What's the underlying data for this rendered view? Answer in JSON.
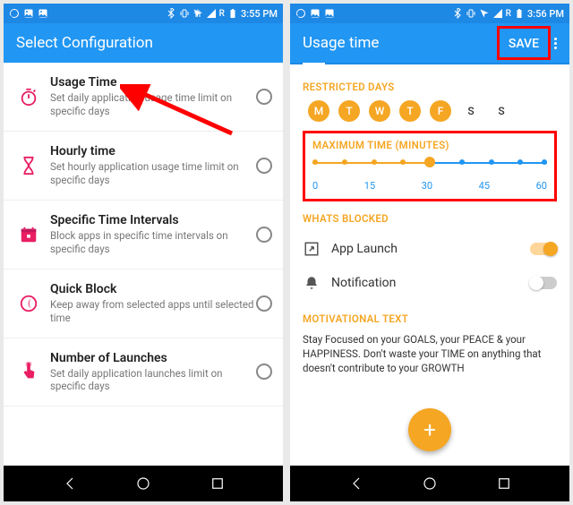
{
  "status": {
    "time_left": "3:55 PM",
    "time_right": "3:56 PM",
    "carrier": "R"
  },
  "left": {
    "title": "Select Configuration",
    "rows": [
      {
        "title": "Usage Time",
        "sub": "Set daily application usage time limit on specific days"
      },
      {
        "title": "Hourly time",
        "sub": "Set hourly application usage time limit on specific days"
      },
      {
        "title": "Specific Time Intervals",
        "sub": "Block apps in specific time intervals on specific days"
      },
      {
        "title": "Quick Block",
        "sub": "Keep away from selected apps until selected time"
      },
      {
        "title": "Number of Launches",
        "sub": "Set daily application launches limit on specific days"
      }
    ]
  },
  "right": {
    "title": "Usage time",
    "save": "SAVE",
    "sect_days": "RESTRICTED DAYS",
    "days": [
      "M",
      "T",
      "W",
      "T",
      "F",
      "S",
      "S"
    ],
    "sect_max": "MAXIMUM TIME (MINUTES)",
    "slider_labels": [
      "0",
      "15",
      "30",
      "45",
      "60"
    ],
    "sect_blocked": "WHATS BLOCKED",
    "blocked": [
      {
        "label": "App Launch",
        "on": true
      },
      {
        "label": "Notification",
        "on": false
      }
    ],
    "sect_mot": "MOTIVATIONAL TEXT",
    "mot": "Stay Focused on your GOALS, your PEACE & your HAPPINESS. Don't waste your TIME on anything that doesn't contribute to your GROWTH",
    "fab": "+"
  }
}
